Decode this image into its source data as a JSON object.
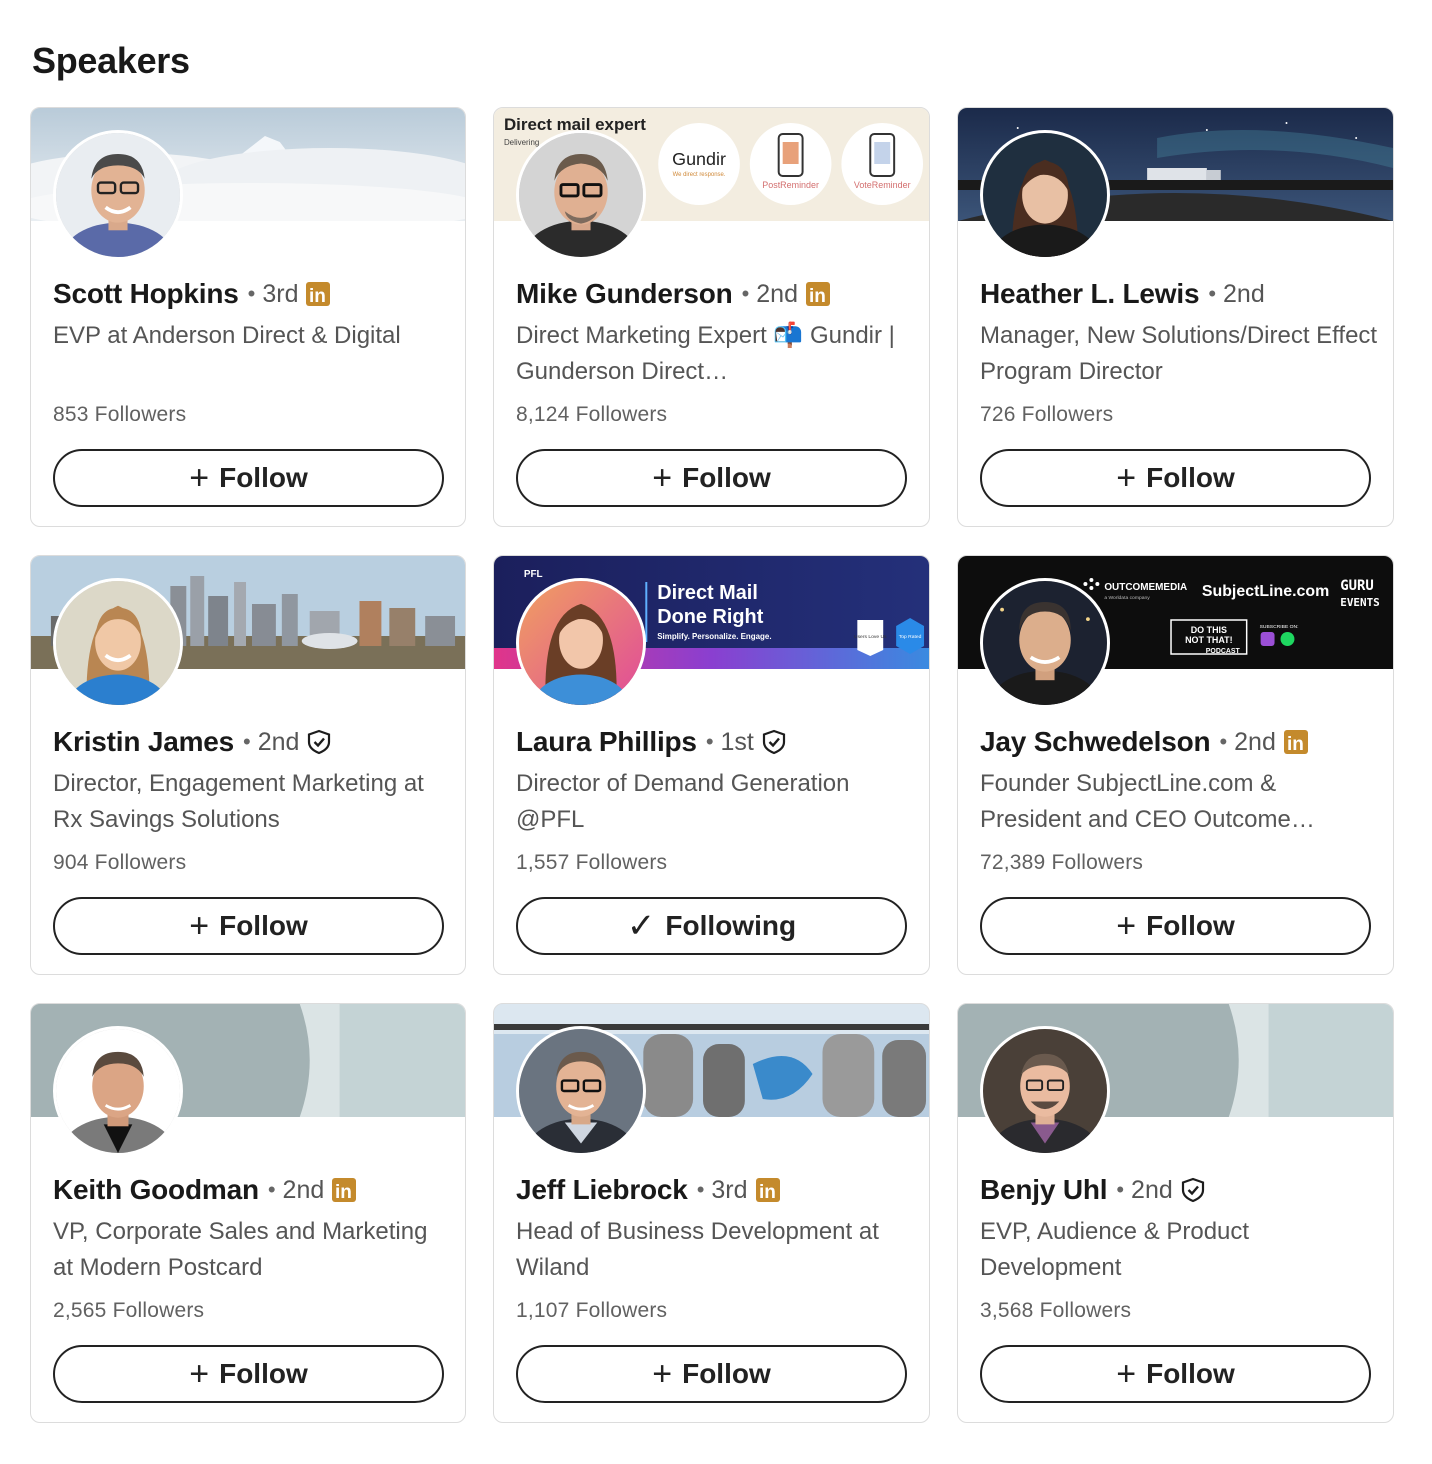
{
  "section": {
    "title": "Speakers"
  },
  "colors": {
    "linkedin_badge": "#c48a2c",
    "text_primary": "#191919",
    "text_secondary": "#555555",
    "border": "#dcdcdc"
  },
  "speakers": [
    {
      "name": "Scott Hopkins",
      "degree": "3rd",
      "badge": "linkedin-premium-icon",
      "headline": "EVP at Anderson Direct & Digital",
      "followers": "853 Followers",
      "button_glyph": "+",
      "button_label": "Follow"
    },
    {
      "name": "Mike Gunderson",
      "degree": "2nd",
      "badge": "linkedin-premium-icon",
      "headline": "Direct Marketing Expert 📬 Gundir | Gunderson Direct…",
      "followers": "8,124 Followers",
      "button_glyph": "+",
      "button_label": "Follow",
      "banner": {
        "title": "Direct mail expert",
        "subtitle": "Delivering …h years",
        "logo": "Gundir",
        "logo_tag": "We direct response.",
        "app1": "PostReminder",
        "app2": "VoteReminder"
      }
    },
    {
      "name": "Heather L. Lewis",
      "degree": "2nd",
      "badge": "",
      "headline": "Manager, New Solutions/Direct Effect Program Director",
      "followers": "726 Followers",
      "button_glyph": "+",
      "button_label": "Follow"
    },
    {
      "name": "Kristin James",
      "degree": "2nd",
      "badge": "verified-icon",
      "headline": "Director, Engagement Marketing at Rx Savings Solutions",
      "followers": "904 Followers",
      "button_glyph": "+",
      "button_label": "Follow"
    },
    {
      "name": "Laura Phillips",
      "degree": "1st",
      "badge": "verified-icon",
      "headline": "Director of Demand Generation @PFL",
      "followers": "1,557 Followers",
      "button_glyph": "✓",
      "button_label": "Following",
      "banner": {
        "brand": "PFL",
        "title1": "Direct Mail",
        "title2": "Done Right",
        "tagline": "Simplify. Personalize. Engage.",
        "award1": "Users Love Us",
        "award2": "Top Rated"
      }
    },
    {
      "name": "Jay Schwedelson",
      "degree": "2nd",
      "badge": "linkedin-premium-icon",
      "headline": "Founder SubjectLine.com & President and CEO Outcome…",
      "followers": "72,389 Followers",
      "button_glyph": "+",
      "button_label": "Follow",
      "banner": {
        "brand1": "OUTCOMEMEDIA",
        "brand1_sub": "a Worldata company",
        "brand2": "SubjectLine.com",
        "brand3_line1": "GURU",
        "brand3_line2": "EVENTS",
        "podcast_line1": "DO THIS",
        "podcast_line2": "NOT THAT!",
        "podcast_line3": "PODCAST",
        "subscribe": "SUBSCRIBE ON:"
      }
    },
    {
      "name": "Keith Goodman",
      "degree": "2nd",
      "badge": "linkedin-premium-icon",
      "headline": "VP, Corporate Sales and Marketing at Modern Postcard",
      "followers": "2,565 Followers",
      "button_glyph": "+",
      "button_label": "Follow"
    },
    {
      "name": "Jeff Liebrock",
      "degree": "3rd",
      "badge": "linkedin-premium-icon",
      "headline": "Head of Business Development at Wiland",
      "followers": "1,107 Followers",
      "button_glyph": "+",
      "button_label": "Follow"
    },
    {
      "name": "Benjy Uhl",
      "degree": "2nd",
      "badge": "verified-icon",
      "headline": "EVP, Audience & Product Development",
      "followers": "3,568 Followers",
      "button_glyph": "+",
      "button_label": "Follow"
    }
  ]
}
